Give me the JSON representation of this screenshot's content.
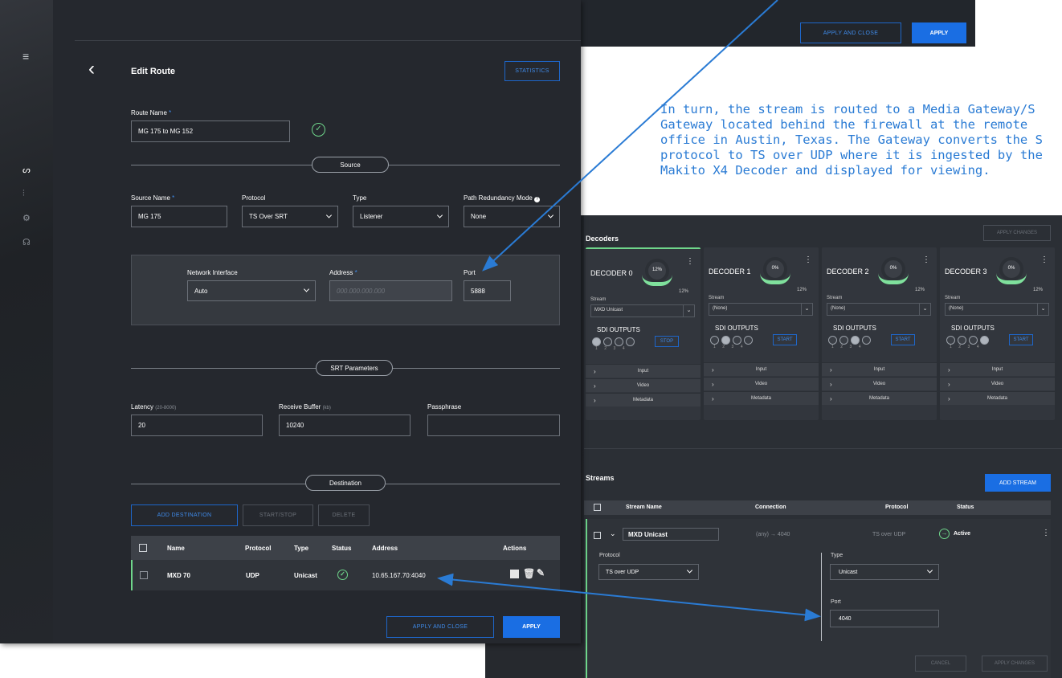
{
  "top_panel": {
    "apply_close": "APPLY AND CLOSE",
    "apply": "APPLY"
  },
  "explanation": [
    "In turn, the stream is routed to a Media Gateway/S",
    "Gateway located behind the firewall at the remote",
    "office in Austin, Texas. The Gateway converts the S",
    "protocol to TS over UDP where it is ingested by the",
    "Makito X4 Decoder and displayed for viewing."
  ],
  "edit_route": {
    "title": "Edit Route",
    "statistics": "STATISTICS",
    "route_name_label": "Route Name",
    "route_name_value": "MG 175 to MG 152",
    "req_mark": "*",
    "source_pill": "Source",
    "source_name_label": "Source Name",
    "source_name_value": "MG 175",
    "protocol_label": "Protocol",
    "protocol_value": "TS Over SRT",
    "type_label": "Type",
    "type_value": "Listener",
    "prm_label": "Path Redundancy Mode",
    "prm_value": "None",
    "net_iface_label": "Network Interface",
    "net_iface_value": "Auto",
    "address_label": "Address",
    "address_placeholder": "000.000.000.000",
    "port_label": "Port",
    "port_value": "5888",
    "srt_pill": "SRT Parameters",
    "latency_label": "Latency",
    "latency_range": "(20-8000)",
    "latency_value": "20",
    "rcvbuf_label": "Receive Buffer",
    "rcvbuf_unit": "(kb)",
    "rcvbuf_value": "10240",
    "passphrase_label": "Passphrase",
    "passphrase_value": "",
    "dest_pill": "Destination",
    "add_destination": "ADD DESTINATION",
    "start_stop": "START/STOP",
    "delete": "DELETE",
    "table_headers": {
      "name": "Name",
      "protocol": "Protocol",
      "type": "Type",
      "status": "Status",
      "address": "Address",
      "actions": "Actions"
    },
    "table_row": {
      "name": "MXD 70",
      "protocol": "UDP",
      "type": "Unicast",
      "address": "10.65.167.70:4040"
    },
    "apply_close": "APPLY AND CLOSE",
    "apply": "APPLY"
  },
  "decoders": {
    "title": "Decoders",
    "apply_changes": "APPLY CHANGES",
    "stream_label": "Stream",
    "sdi_outputs": "SDI OUTPUTS",
    "accordions": [
      "Input",
      "Video",
      "Metadata"
    ],
    "port_numbers": "1234",
    "cards": [
      {
        "name": "DECODER 0",
        "pct": "12%",
        "pct2": "12%",
        "stream": "MXD Unicast",
        "button": "STOP",
        "active_dot": 0
      },
      {
        "name": "DECODER 1",
        "pct": "0%",
        "pct2": "12%",
        "stream": "(None)",
        "button": "START",
        "active_dot": 1
      },
      {
        "name": "DECODER 2",
        "pct": "0%",
        "pct2": "12%",
        "stream": "(None)",
        "button": "START",
        "active_dot": 2
      },
      {
        "name": "DECODER 3",
        "pct": "0%",
        "pct2": "12%",
        "stream": "(None)",
        "button": "START",
        "active_dot": 3
      }
    ]
  },
  "streams": {
    "title": "Streams",
    "add_stream": "ADD STREAM",
    "headers": {
      "name": "Stream Name",
      "connection": "Connection",
      "protocol": "Protocol",
      "status": "Status"
    },
    "row": {
      "name": "MXD Unicast",
      "connection": "(any) → 4040",
      "protocol": "TS over UDP",
      "status": "Active"
    },
    "protocol_label": "Protocol",
    "protocol_value": "TS over UDP",
    "type_label": "Type",
    "type_value": "Unicast",
    "port_label": "Port",
    "port_value": "4040",
    "cancel": "CANCEL",
    "apply_changes": "APPLY CHANGES"
  },
  "colors": {
    "accent": "#1a6ee3",
    "arrow": "#2a7bd4",
    "active_green": "#6fd68b"
  }
}
